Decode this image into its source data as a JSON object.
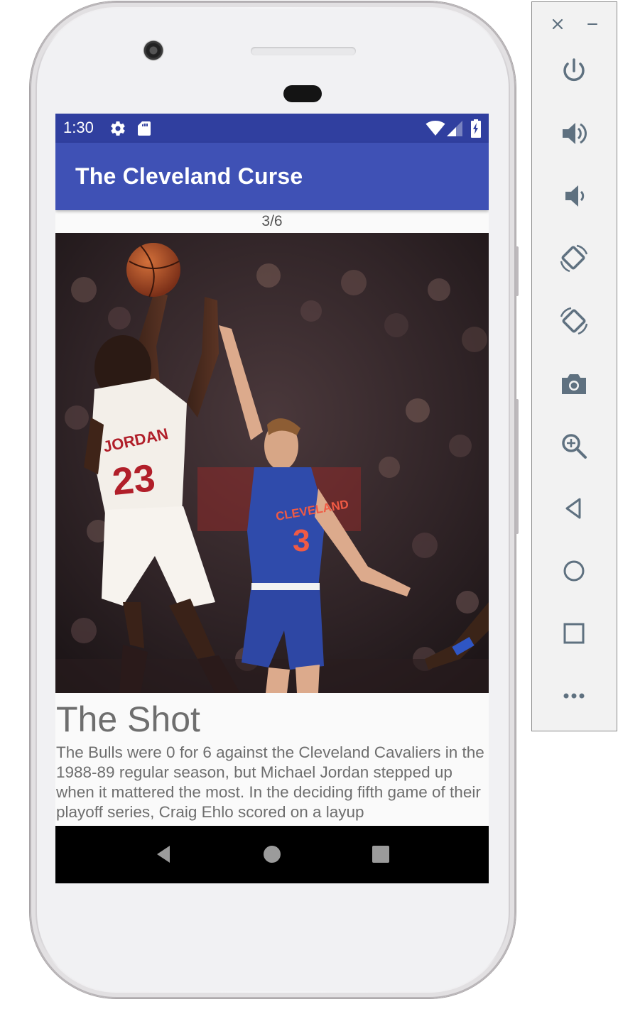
{
  "status_bar": {
    "time": "1:30",
    "icons": [
      "settings-icon",
      "sd-card-icon",
      "wifi-icon",
      "cell-signal-icon",
      "battery-charging-icon"
    ]
  },
  "app_bar": {
    "title": "The Cleveland Curse"
  },
  "pager": {
    "counter": "3/6"
  },
  "photo": {
    "player_left": {
      "jersey_name": "JORDAN",
      "jersey_number": "23"
    },
    "player_right": {
      "jersey_name": "CLEVELAND",
      "jersey_number": "3"
    }
  },
  "story": {
    "title": "The Shot",
    "body": "The Bulls were 0 for 6 against the Cleveland Cavaliers in the 1988-89 regular season, but Michael Jordan stepped up when it mattered the most. In the deciding fifth game of their playoff series, Craig Ehlo scored on a layup"
  },
  "nav_bar": {
    "buttons": [
      "back-icon",
      "home-icon",
      "recents-icon"
    ]
  },
  "emulator_toolbar": {
    "window_controls": [
      "close-icon",
      "minimize-icon"
    ],
    "buttons": [
      "power-icon",
      "volume-up-icon",
      "volume-down-icon",
      "rotate-left-icon",
      "rotate-right-icon",
      "camera-icon",
      "zoom-icon",
      "back-icon",
      "home-icon",
      "overview-icon",
      "more-icon"
    ]
  },
  "colors": {
    "status_bar": "#303f9f",
    "app_bar": "#3f51b5",
    "toolbar_icon": "#5f7180",
    "story_text": "#6e6e6e"
  }
}
